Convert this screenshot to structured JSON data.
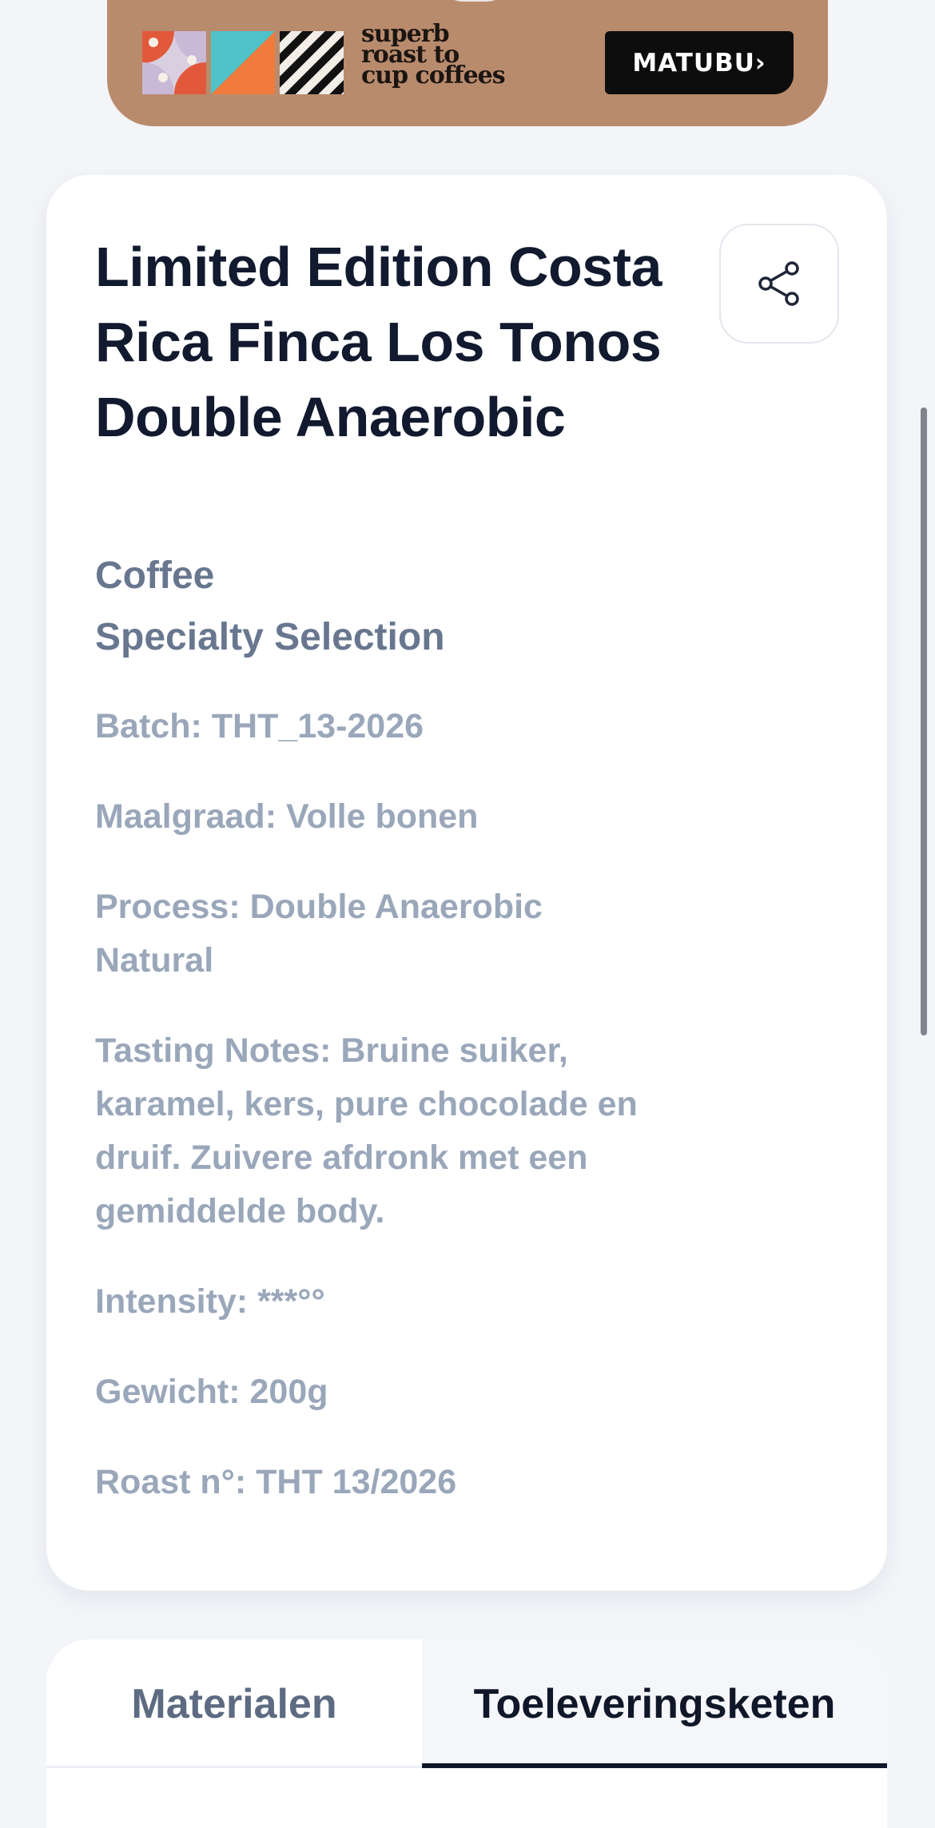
{
  "banner": {
    "tagline_line1": "superb",
    "tagline_line2": "roast to",
    "tagline_line3": "cup coffees",
    "brand_logo": "MATUBU›",
    "colors": {
      "background": "#b98b6d",
      "logo_bg": "#0d0d0d"
    }
  },
  "product": {
    "title": "Limited Edition Costa Rica Finca Los Tonos Double Anaerobic",
    "category": "Coffee",
    "subcategory": "Specialty Selection",
    "attributes": [
      "Batch: THT_13-2026",
      "Maalgraad: Volle bonen",
      "Process: Double Anaerobic Natural",
      "Tasting Notes: Bruine suiker, karamel, kers, pure chocolade en druif. Zuivere afdronk met een gemiddelde body.",
      "Intensity: ***°°",
      "Gewicht: 200g",
      "Roast n°: THT 13/2026"
    ],
    "share_icon": "share-icon"
  },
  "tabs": {
    "items": [
      {
        "label": "Materialen",
        "active": false
      },
      {
        "label": "Toeleveringsketen",
        "active": true
      }
    ]
  },
  "colors": {
    "page_bg": "#f3f5f9",
    "title": "#111a2e",
    "category": "#68778f",
    "attribute": "#9aa7ba",
    "active_tab": "#0f1729"
  }
}
